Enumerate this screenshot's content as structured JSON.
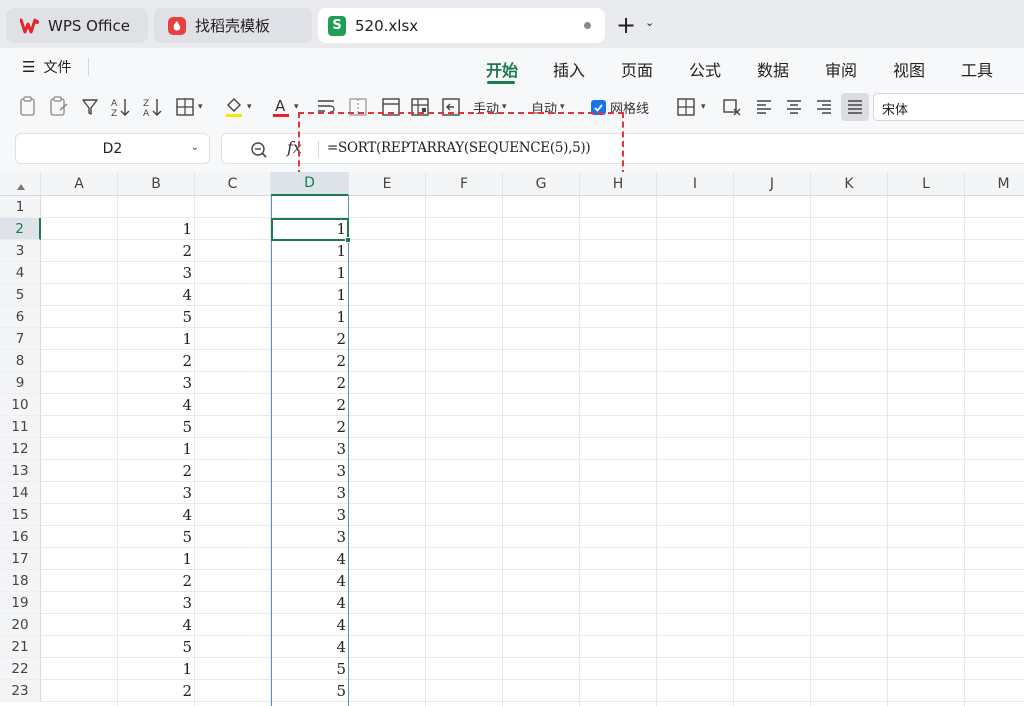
{
  "tabs": {
    "wps": "WPS Office",
    "template": "找稻壳模板",
    "file": "520.xlsx",
    "new_tab": "+",
    "file_logo": "S"
  },
  "menu": {
    "file": "文件",
    "ribbon_tabs": [
      "开始",
      "插入",
      "页面",
      "公式",
      "数据",
      "审阅",
      "视图",
      "工具"
    ],
    "active_tab": "开始"
  },
  "toolbar": {
    "manual_label": "手动",
    "auto_label": "自动",
    "gridlines_label": "网格线",
    "gridlines_checked": true,
    "font_name": "宋体",
    "fill_color": "#f5e900",
    "font_color": "#e8222a"
  },
  "formula_bar": {
    "name_box": "D2",
    "fx": "fx",
    "formula": "=SORT(REPTARRAY(SEQUENCE(5),5))"
  },
  "sheet": {
    "columns": [
      "A",
      "B",
      "C",
      "D",
      "E",
      "F",
      "G",
      "H",
      "I",
      "J",
      "K",
      "L",
      "M"
    ],
    "selected_column": "D",
    "rows": [
      "1",
      "2",
      "3",
      "4",
      "5",
      "6",
      "7",
      "8",
      "9",
      "10",
      "11",
      "12",
      "13",
      "14",
      "15",
      "16",
      "17",
      "18",
      "19",
      "20",
      "21",
      "22",
      "23"
    ],
    "selected_row": "2",
    "active_cell": "D2",
    "col_B": [
      "",
      "1",
      "2",
      "3",
      "4",
      "5",
      "1",
      "2",
      "3",
      "4",
      "5",
      "1",
      "2",
      "3",
      "4",
      "5",
      "1",
      "2",
      "3",
      "4",
      "5",
      "1",
      "2"
    ],
    "col_D": [
      "",
      "1",
      "1",
      "1",
      "1",
      "1",
      "2",
      "2",
      "2",
      "2",
      "2",
      "3",
      "3",
      "3",
      "3",
      "3",
      "4",
      "4",
      "4",
      "4",
      "4",
      "5",
      "5"
    ]
  },
  "colors": {
    "accent_green": "#1e7a4f",
    "highlight_red": "#e0363a",
    "selection_blue": "#5d8fd6"
  }
}
